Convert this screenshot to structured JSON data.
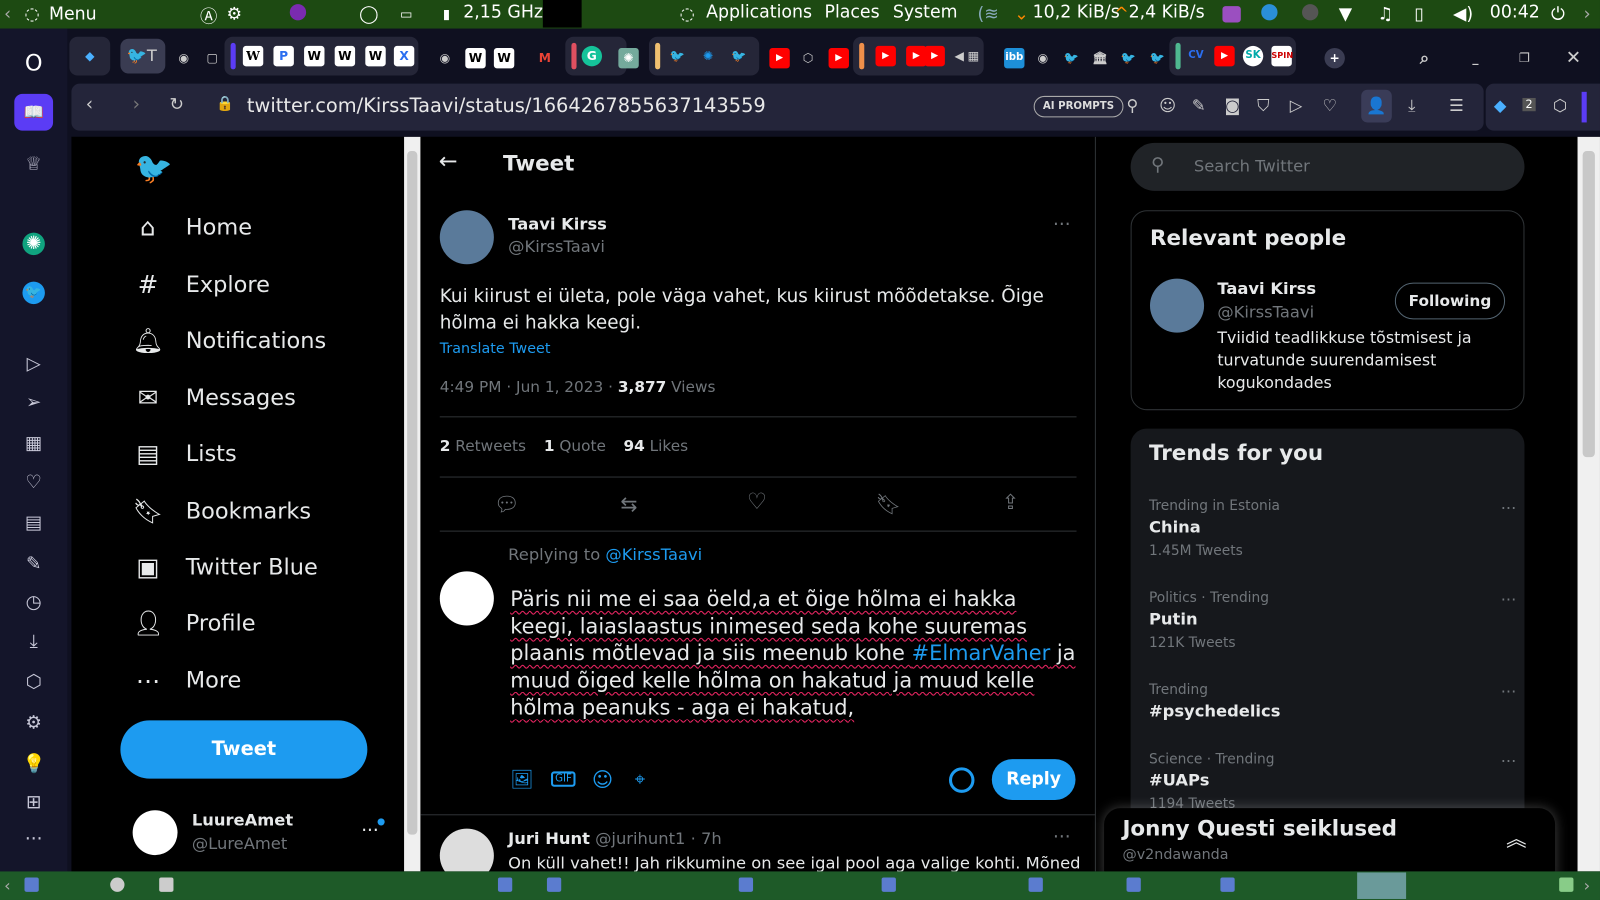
{
  "panel": {
    "menu": "Menu",
    "cpu": "2,15 GHz",
    "applications": "Applications",
    "places": "Places",
    "system": "System",
    "net_down": "10,2 KiB/s",
    "net_up": "2,4 KiB/s",
    "clock": "00:42"
  },
  "browser": {
    "url": "twitter.com/KirssTaavi/status/1664267855637143559",
    "ai_prompts": "AI PROMPTS",
    "active_tab_letter": "T",
    "workspace_badge": "2"
  },
  "nav": {
    "home": "Home",
    "explore": "Explore",
    "notifications": "Notifications",
    "messages": "Messages",
    "lists": "Lists",
    "bookmarks": "Bookmarks",
    "twitter_blue": "Twitter Blue",
    "profile": "Profile",
    "more": "More",
    "tweet": "Tweet"
  },
  "account": {
    "name": "LuureAmet",
    "handle": "@LureAmet"
  },
  "header": {
    "title": "Tweet"
  },
  "tweet": {
    "name": "Taavi Kirss",
    "handle": "@KirssTaavi",
    "text": "Kui kiirust ei ületa, pole väga vahet, kus kiirust mõõdetakse. Õige hõlma ei hakka keegi.",
    "translate": "Translate Tweet",
    "time": "4:49 PM · Jun 1, 2023 · ",
    "views": "3,877",
    "views_label": " Views",
    "retweets": "2",
    "retweets_label": " Retweets",
    "quotes": "1",
    "quotes_label": " Quote",
    "likes": "94",
    "likes_label": " Likes"
  },
  "reply": {
    "replying_to": "Replying to ",
    "replying_handle": "@KirssTaavi",
    "text_1": "Päris nii me ei saa öeld,a et õige hõlma ei hakka keegi, laiaslaastus inimesed seda kohe suuremas plaanis mõtlevad ja siis meenub kohe ",
    "hashtag": "#ElmarVaher",
    "text_2": " ja muud õiged kelle hõlma on hakatud ja muud kelle hõlma peanuks - aga ei hakatud,",
    "button": "Reply"
  },
  "next_reply": {
    "name": "Juri Hunt",
    "handle": "@jurihunt1",
    "time": "· 7h",
    "text": "On küll vahet!! Jah rikkumine on see igal pool aga valige kohti. Mõned"
  },
  "search": {
    "placeholder": "Search Twitter"
  },
  "relevant": {
    "title": "Relevant people",
    "name": "Taavi Kirss",
    "handle": "@KirssTaavi",
    "follow": "Following",
    "bio": "Tviidid teadlikkuse tõstmisest ja turvatunde suurendamisest kogukondades"
  },
  "trends": {
    "title": "Trends for you",
    "items": [
      {
        "context": "Trending in Estonia",
        "name": "China",
        "count": "1.45M Tweets"
      },
      {
        "context": "Politics · Trending",
        "name": "Putin",
        "count": "121K Tweets"
      },
      {
        "context": "Trending",
        "name": "#psychedelics",
        "count": ""
      },
      {
        "context": "Science · Trending",
        "name": "#UAPs",
        "count": "1194 Tweets"
      }
    ]
  },
  "messages_drawer": {
    "title": "Jonny Questi seiklused",
    "handle": "@v2ndawanda"
  },
  "colors": {
    "accent": "#1d9bf0",
    "panel": "#1d4a12",
    "opera": "#5b3cf5"
  }
}
